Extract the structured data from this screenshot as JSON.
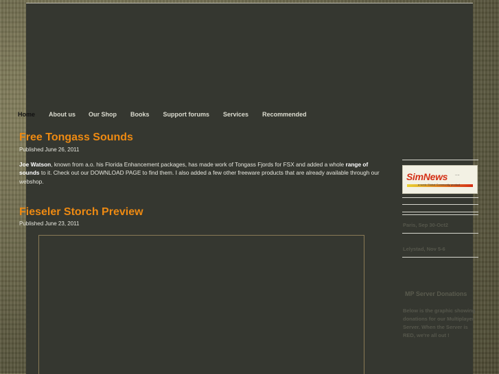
{
  "nav": {
    "items": [
      {
        "label": "Home"
      },
      {
        "label": "About us"
      },
      {
        "label": "Our Shop"
      },
      {
        "label": "Books"
      },
      {
        "label": "Support forums"
      },
      {
        "label": "Services"
      },
      {
        "label": "Recommended"
      }
    ]
  },
  "posts": [
    {
      "title": "Free Tongass Sounds",
      "published": "Published June 26, 2011",
      "body": {
        "author": "Joe Watson",
        "text1": ", known from a.o. his Florida Enhancement packages, has made work of Tongass Fjords for FSX and added a whole ",
        "bold": "range of sounds",
        "text2": " to it. Check out our DOWNLOAD PAGE to find them. I also added a few other freeware products that are already available through our webshop."
      }
    },
    {
      "title": "Fieseler Storch Preview",
      "published": "Published June 23, 2011"
    }
  ],
  "sidebar": {
    "logo": {
      "text": "SimNews",
      "dots": "....",
      "tagline": "a sonic Global Community product"
    },
    "events": [
      {
        "label": "Paris, Sep 30-Oct2"
      },
      {
        "label": "Lelystad, Nov 5-6"
      }
    ],
    "donations": {
      "title": "MP Server Donations",
      "text": "Below is the graphic showing donations for our Multiplayer Server. When the Server is RED, we're all out !"
    }
  },
  "colors": {
    "accent": "#ee8a12",
    "content_bg": "#353730",
    "nav_active": "#111111",
    "sidebar_text": "#56574c"
  }
}
